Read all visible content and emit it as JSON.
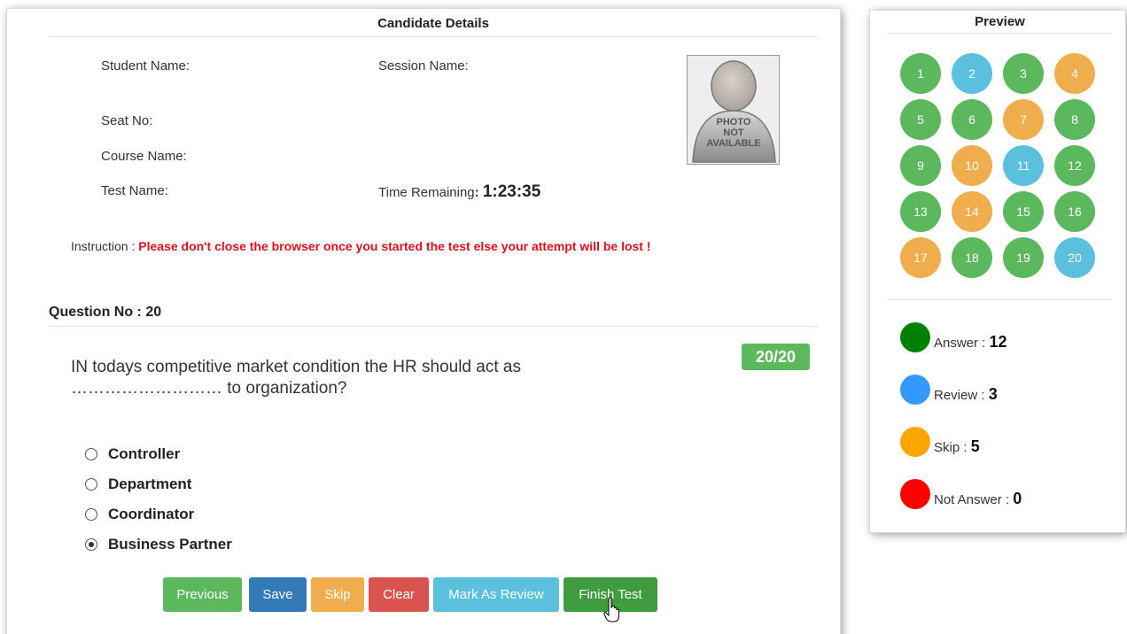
{
  "candidate": {
    "title": "Candidate Details",
    "student_name_label": "Student Name:",
    "session_name_label": "Session Name:",
    "seat_no_label": "Seat No:",
    "course_name_label": "Course Name:",
    "test_name_label": "Test Name:",
    "time_remaining_label": "Time Remaining",
    "time_remaining_sep": ": ",
    "time_remaining_value": "1:23:35",
    "photo_text": [
      "PHOTO",
      "NOT",
      "AVAILABLE"
    ]
  },
  "instruction": {
    "label": "Instruction : ",
    "text": "Please don't close the browser once you started the test else your attempt will be lost !"
  },
  "question": {
    "number_label": "Question No :  20",
    "progress_badge": "20/20",
    "text_line1": "IN todays competitive market condition the HR should act as",
    "text_line2": "……………………… to organization?",
    "options": [
      {
        "label": "Controller",
        "selected": false
      },
      {
        "label": "Department",
        "selected": false
      },
      {
        "label": "Coordinator",
        "selected": false
      },
      {
        "label": "Business Partner",
        "selected": true
      }
    ]
  },
  "buttons": {
    "previous": "Previous",
    "save": "Save",
    "skip": "Skip",
    "clear": "Clear",
    "mark_review": "Mark As Review",
    "finish": "Finish Test"
  },
  "preview": {
    "title": "Preview",
    "questions": [
      {
        "n": "1",
        "status": "answer"
      },
      {
        "n": "2",
        "status": "review"
      },
      {
        "n": "3",
        "status": "answer"
      },
      {
        "n": "4",
        "status": "skip"
      },
      {
        "n": "5",
        "status": "answer"
      },
      {
        "n": "6",
        "status": "answer"
      },
      {
        "n": "7",
        "status": "skip"
      },
      {
        "n": "8",
        "status": "answer"
      },
      {
        "n": "9",
        "status": "answer"
      },
      {
        "n": "10",
        "status": "skip"
      },
      {
        "n": "11",
        "status": "review"
      },
      {
        "n": "12",
        "status": "answer"
      },
      {
        "n": "13",
        "status": "answer"
      },
      {
        "n": "14",
        "status": "skip"
      },
      {
        "n": "15",
        "status": "answer"
      },
      {
        "n": "16",
        "status": "answer"
      },
      {
        "n": "17",
        "status": "skip"
      },
      {
        "n": "18",
        "status": "answer"
      },
      {
        "n": "19",
        "status": "answer"
      },
      {
        "n": "20",
        "status": "review"
      }
    ],
    "legend": {
      "answer_label": "Answer : ",
      "answer_count": "12",
      "review_label": "Review : ",
      "review_count": "3",
      "skip_label": "Skip : ",
      "skip_count": "5",
      "not_answer_label": "Not Answer : ",
      "not_answer_count": "0"
    }
  },
  "colors": {
    "answer": "#5cb85c",
    "review": "#5bc0de",
    "skip": "#f0ad4e",
    "legend_answer": "#008000",
    "legend_review": "#3399ff",
    "legend_skip": "#ffa500",
    "legend_not_answer": "#ff0000",
    "btn_previous": "#5cb85c",
    "btn_save": "#337ab7",
    "btn_skip": "#f0ad4e",
    "btn_clear": "#d9534f",
    "btn_mark_review": "#5bc0de",
    "btn_finish": "#3e9c3e",
    "badge": "#5cb85c",
    "warning_text": "#e0101a"
  },
  "icons": {
    "cursor": "hand-pointer-icon",
    "photo": "photo-placeholder-icon"
  }
}
